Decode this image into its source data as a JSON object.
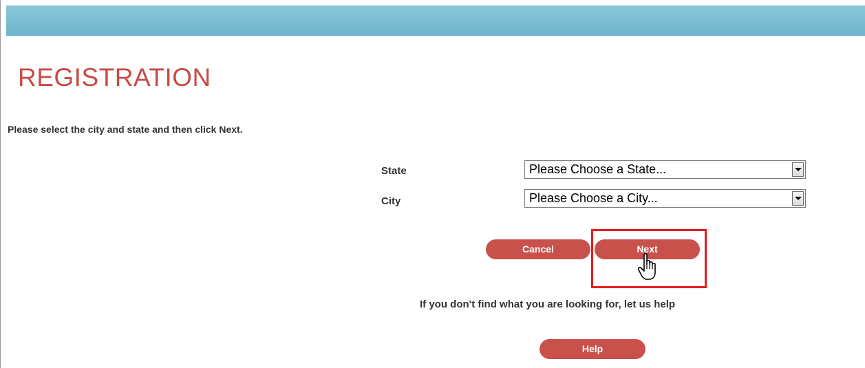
{
  "header": {
    "title": "REGISTRATION"
  },
  "form": {
    "instructions": "Please select the city and state and then click Next.",
    "state": {
      "label": "State",
      "value": "Please Choose a State..."
    },
    "city": {
      "label": "City",
      "value": "Please Choose a City..."
    }
  },
  "buttons": {
    "cancel": "Cancel",
    "next": "Next",
    "help": "Help"
  },
  "help": {
    "text": "If you don't find what you are looking for, let us help"
  },
  "colors": {
    "accent": "#c9514b",
    "title": "#c84b45",
    "top_bar": "#7dbdd3",
    "highlight": "#e41d1d"
  },
  "icons": {
    "cursor": "hand-pointer-icon",
    "dropdown": "chevron-down-icon"
  }
}
